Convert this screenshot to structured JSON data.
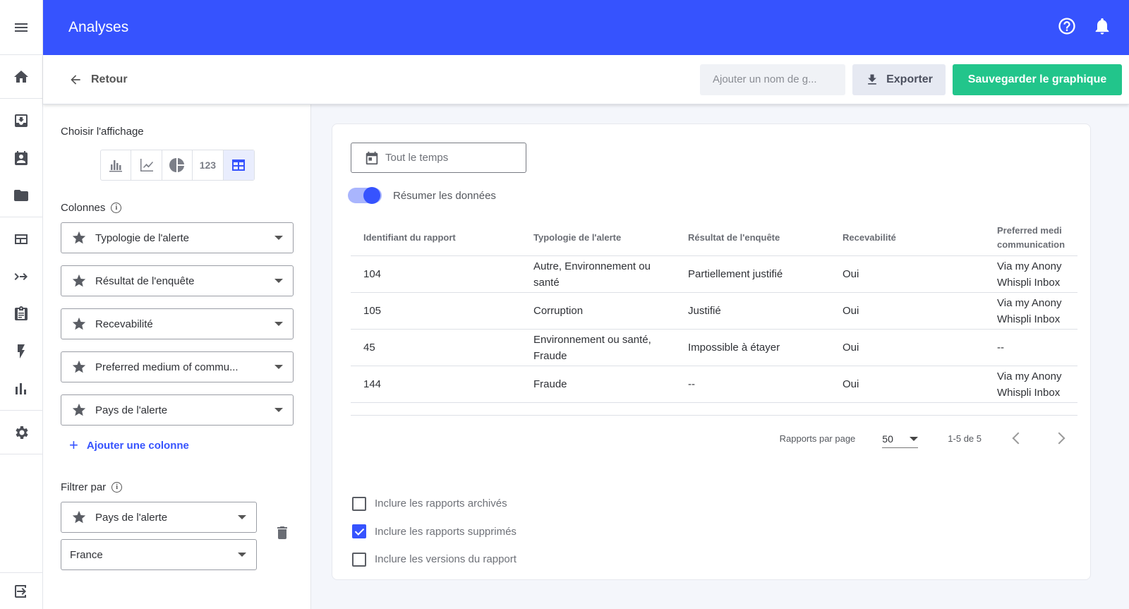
{
  "topbar": {
    "title": "Analyses"
  },
  "subbar": {
    "back_label": "Retour",
    "name_placeholder": "Ajouter un nom de g...",
    "export_label": "Exporter",
    "save_label": "Sauvegarder le graphique"
  },
  "left_panel": {
    "display_label": "Choisir l'affichage",
    "display_modes": [
      "bar-chart",
      "line-chart",
      "pie-chart",
      "number",
      "table"
    ],
    "number_mode_label": "123",
    "selected_mode": "table",
    "columns_label": "Colonnes",
    "columns": [
      "Typologie de l'alerte",
      "Résultat de l'enquête",
      "Recevabilité",
      "Preferred medium of commu...",
      "Pays de l'alerte"
    ],
    "add_column_label": "Ajouter une colonne",
    "filter_label": "Filtrer par",
    "filter_field": "Pays de l'alerte",
    "filter_value": "France"
  },
  "main": {
    "date_range": "Tout le temps",
    "summarize_label": "Résumer les données",
    "summarize_on": true,
    "table": {
      "headers": [
        "Identifiant du rapport",
        "Typologie de l'alerte",
        "Résultat de l'enquête",
        "Recevabilité",
        "Preferred medi communication"
      ],
      "header5_line1": "Preferred medi",
      "header5_line2": "communication",
      "rows": [
        {
          "id": "104",
          "type_l1": "Autre, Environnement ou",
          "type_l2": "santé",
          "result": "Partiellement justifié",
          "recv": "Oui",
          "med_l1": "Via my Anony",
          "med_l2": "Whispli Inbox"
        },
        {
          "id": "105",
          "type_l1": "Corruption",
          "type_l2": "",
          "result": "Justifié",
          "recv": "Oui",
          "med_l1": "Via my Anony",
          "med_l2": "Whispli Inbox"
        },
        {
          "id": "45",
          "type_l1": "Environnement ou santé,",
          "type_l2": "Fraude",
          "result": "Impossible à étayer",
          "recv": "Oui",
          "med_l1": "--",
          "med_l2": ""
        },
        {
          "id": "144",
          "type_l1": "Fraude",
          "type_l2": "",
          "result": "--",
          "recv": "Oui",
          "med_l1": "Via my Anony",
          "med_l2": "Whispli Inbox"
        }
      ]
    },
    "pagination": {
      "per_page_label": "Rapports par page",
      "per_page_value": "50",
      "range": "1-5 de 5"
    },
    "checkboxes": [
      {
        "label": "Inclure les rapports archivés",
        "checked": false
      },
      {
        "label": "Inclure les rapports supprimés",
        "checked": true
      },
      {
        "label": "Inclure les versions du rapport",
        "checked": false
      }
    ]
  },
  "colors": {
    "primary": "#3653fe",
    "save_green": "#22c58b"
  }
}
